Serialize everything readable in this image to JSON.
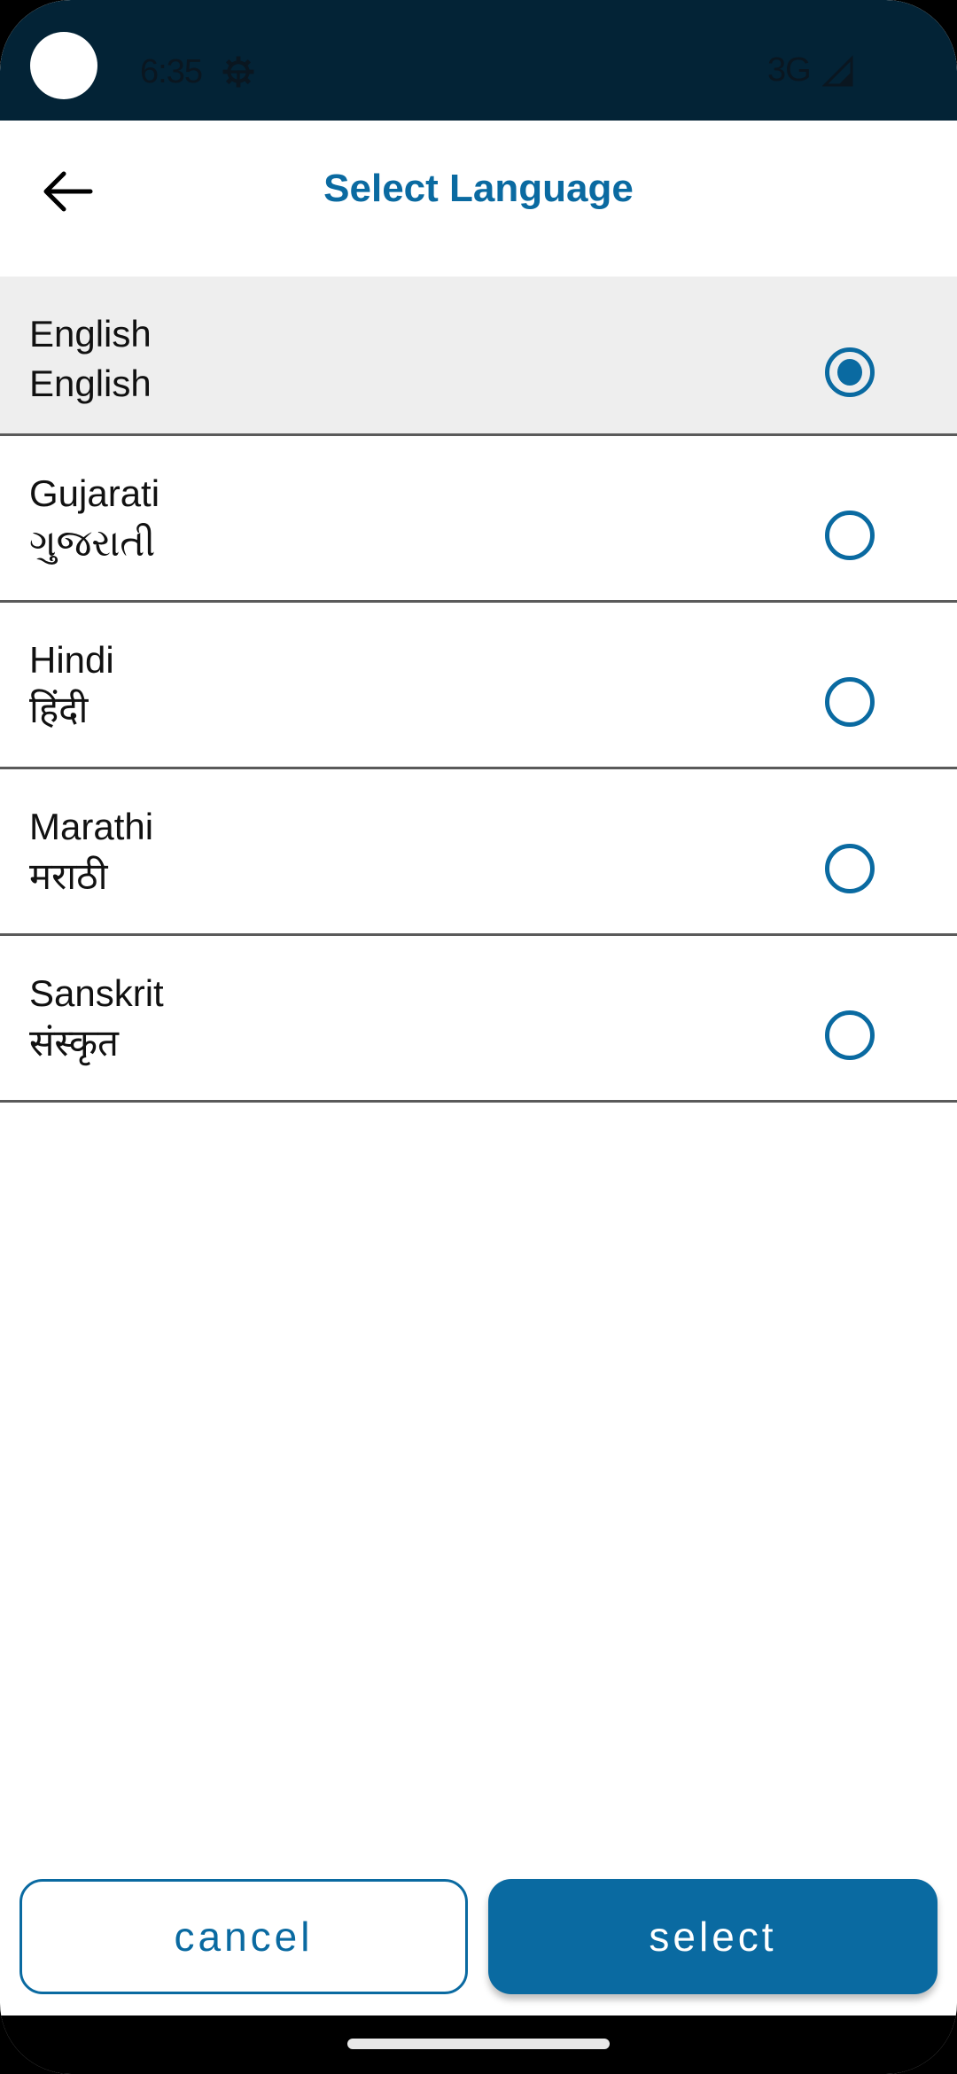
{
  "status_bar": {
    "time": "6:35",
    "network": "3G",
    "icons": [
      "camera-cutout",
      "settings-gear-icon",
      "signal-icon"
    ]
  },
  "app_bar": {
    "title": "Select Language",
    "back_icon": "arrow-left-icon"
  },
  "languages": [
    {
      "name": "English",
      "native": "English",
      "selected": true
    },
    {
      "name": "Gujarati",
      "native": "ગુજરાતી",
      "selected": false
    },
    {
      "name": "Hindi",
      "native": "हिंदी",
      "selected": false
    },
    {
      "name": "Marathi",
      "native": "मराठी",
      "selected": false
    },
    {
      "name": "Sanskrit",
      "native": "संस्कृत",
      "selected": false
    }
  ],
  "footer": {
    "cancel_label": "cancel",
    "select_label": "select"
  },
  "colors": {
    "accent": "#0a6aa1",
    "status_bar_bg": "#032336",
    "selected_row_bg": "#eeeeee",
    "divider": "#5a5a5a"
  }
}
